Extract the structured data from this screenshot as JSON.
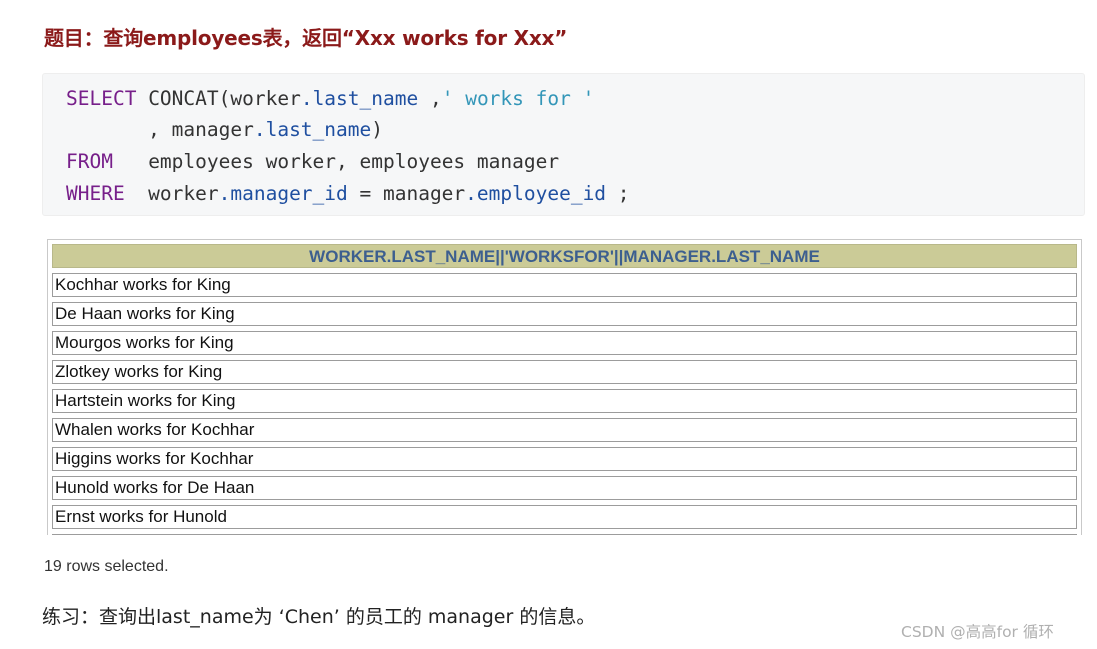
{
  "heading": "题目：查询employees表，返回“Xxx works for Xxx”",
  "code": {
    "line1": {
      "kw": "SELECT",
      "a": " CONCAT(worker",
      "b": ".last_name",
      "c": " ,",
      "d": "' works for '"
    },
    "line2": {
      "a": "       , manager",
      "b": ".last_name",
      "c": ")"
    },
    "line3": {
      "kw": "FROM",
      "a": "   employees worker, employees manager"
    },
    "line4": {
      "kw": "WHERE",
      "a": "  worker",
      "b": ".manager_id",
      "c": " = manager",
      "d": ".employee_id",
      "e": " ;"
    }
  },
  "result": {
    "header": "WORKER.LAST_NAME||'WORKSFOR'||MANAGER.LAST_NAME",
    "rows": [
      "Kochhar works for King",
      "De Haan works for King",
      "Mourgos works for King",
      "Zlotkey works for King",
      "Hartstein works for King",
      "Whalen works for Kochhar",
      "Higgins works for Kochhar",
      "Hunold works for De Haan",
      "Ernst works for Hunold"
    ]
  },
  "rows_selected": "19 rows selected.",
  "practice": "练习：查询出last_name为 ‘Chen’ 的员工的 manager 的信息。",
  "watermark": "CSDN @高高for 循环",
  "colors": {
    "heading": "#8b1a1a",
    "keyword": "#771f8a",
    "property": "#1f4fa0",
    "string": "#3396b8",
    "header_bg": "#cbcb97",
    "header_text": "#3d5f8f"
  }
}
